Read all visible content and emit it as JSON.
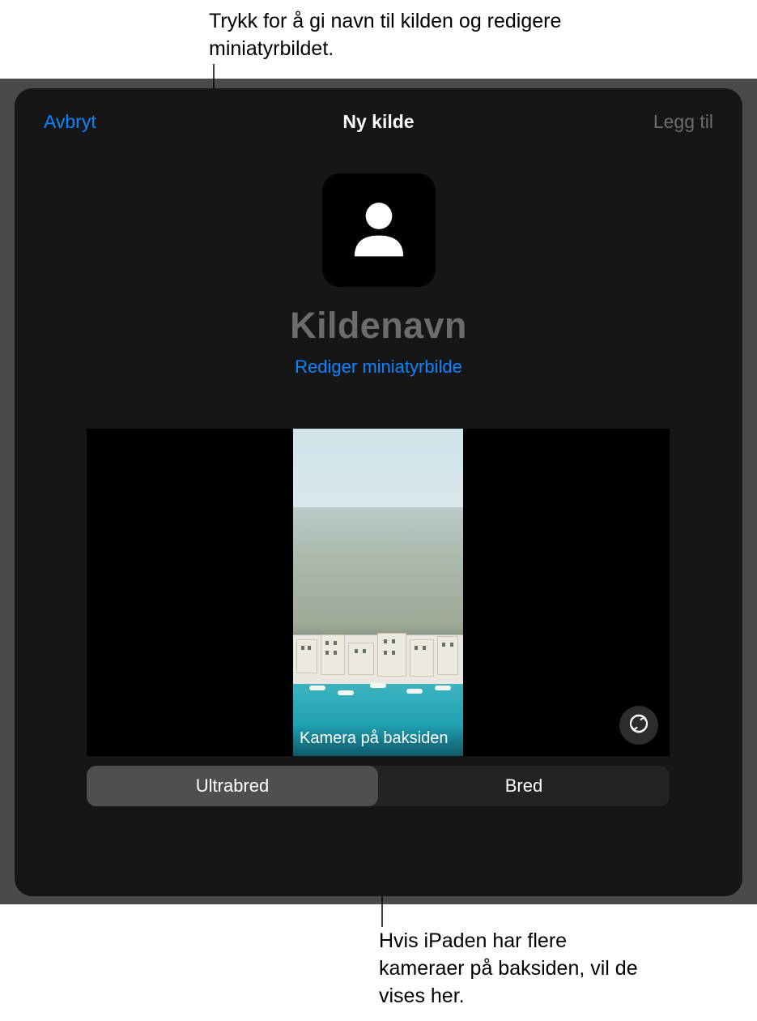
{
  "callouts": {
    "top": "Trykk for å gi navn til kilden og redigere miniatyrbildet.",
    "bottom": "Hvis iPaden har flere kameraer på baksiden, vil de vises her."
  },
  "nav": {
    "cancel": "Avbryt",
    "title": "Ny kilde",
    "add": "Legg til"
  },
  "header": {
    "source_name_placeholder": "Kildenavn",
    "edit_thumbnail": "Rediger miniatyrbilde"
  },
  "preview": {
    "camera_label": "Kamera på baksiden"
  },
  "segmented": {
    "options": [
      "Ultrabred",
      "Bred"
    ],
    "selected_index": 0
  },
  "icons": {
    "person": "person-icon",
    "flip_camera": "flip-camera-icon"
  },
  "colors": {
    "accent": "#0a84ff",
    "dialog_bg": "#161616",
    "disabled_text": "#6d6d6f"
  }
}
